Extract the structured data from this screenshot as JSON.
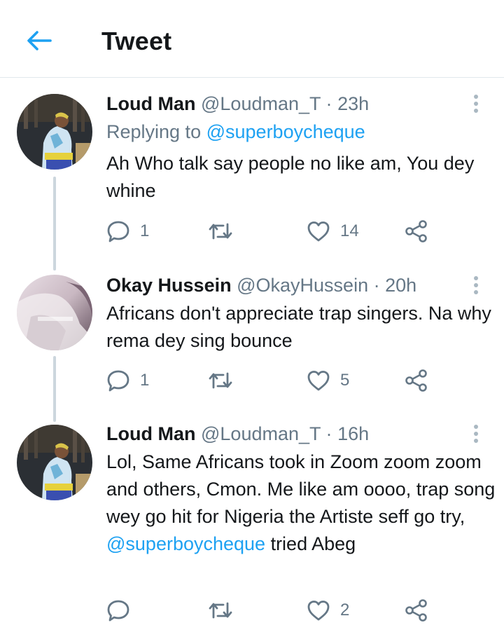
{
  "header": {
    "title": "Tweet",
    "back_icon": "back-arrow-icon",
    "accent": "#1da1f2"
  },
  "tweets": [
    {
      "name": "Loud Man",
      "handle": "@Loudman_T",
      "time": "23h",
      "replying_prefix": "Replying to",
      "replying_to": "@superboycheque",
      "text": "Ah Who talk say people no like am, You dey whine",
      "replies": "1",
      "retweets": "",
      "likes": "14"
    },
    {
      "name": "Okay Hussein",
      "handle": "@OkayHussein",
      "time": "20h",
      "text": "Africans don't appreciate trap singers. Na why rema dey sing bounce",
      "replies": "1",
      "retweets": "",
      "likes": "5"
    },
    {
      "name": "Loud Man",
      "handle": "@Loudman_T",
      "time": "16h",
      "text_before_mention": "Lol, Same Africans took in Zoom zoom zoom and others,  Cmon. Me like am oooo, trap song wey go hit for Nigeria the Artiste seff go try, ",
      "text_mention": "@superboycheque",
      "text_after_mention": " tried Abeg",
      "replies": "",
      "retweets": "",
      "likes": "2"
    }
  ],
  "icons": [
    "reply-icon",
    "retweet-icon",
    "like-icon",
    "share-icon",
    "more-icon"
  ],
  "colors": {
    "text": "#14171a",
    "secondary": "#657786",
    "link": "#1da1f2",
    "divider": "#e1e8ed",
    "thread": "#ccd6dd"
  }
}
